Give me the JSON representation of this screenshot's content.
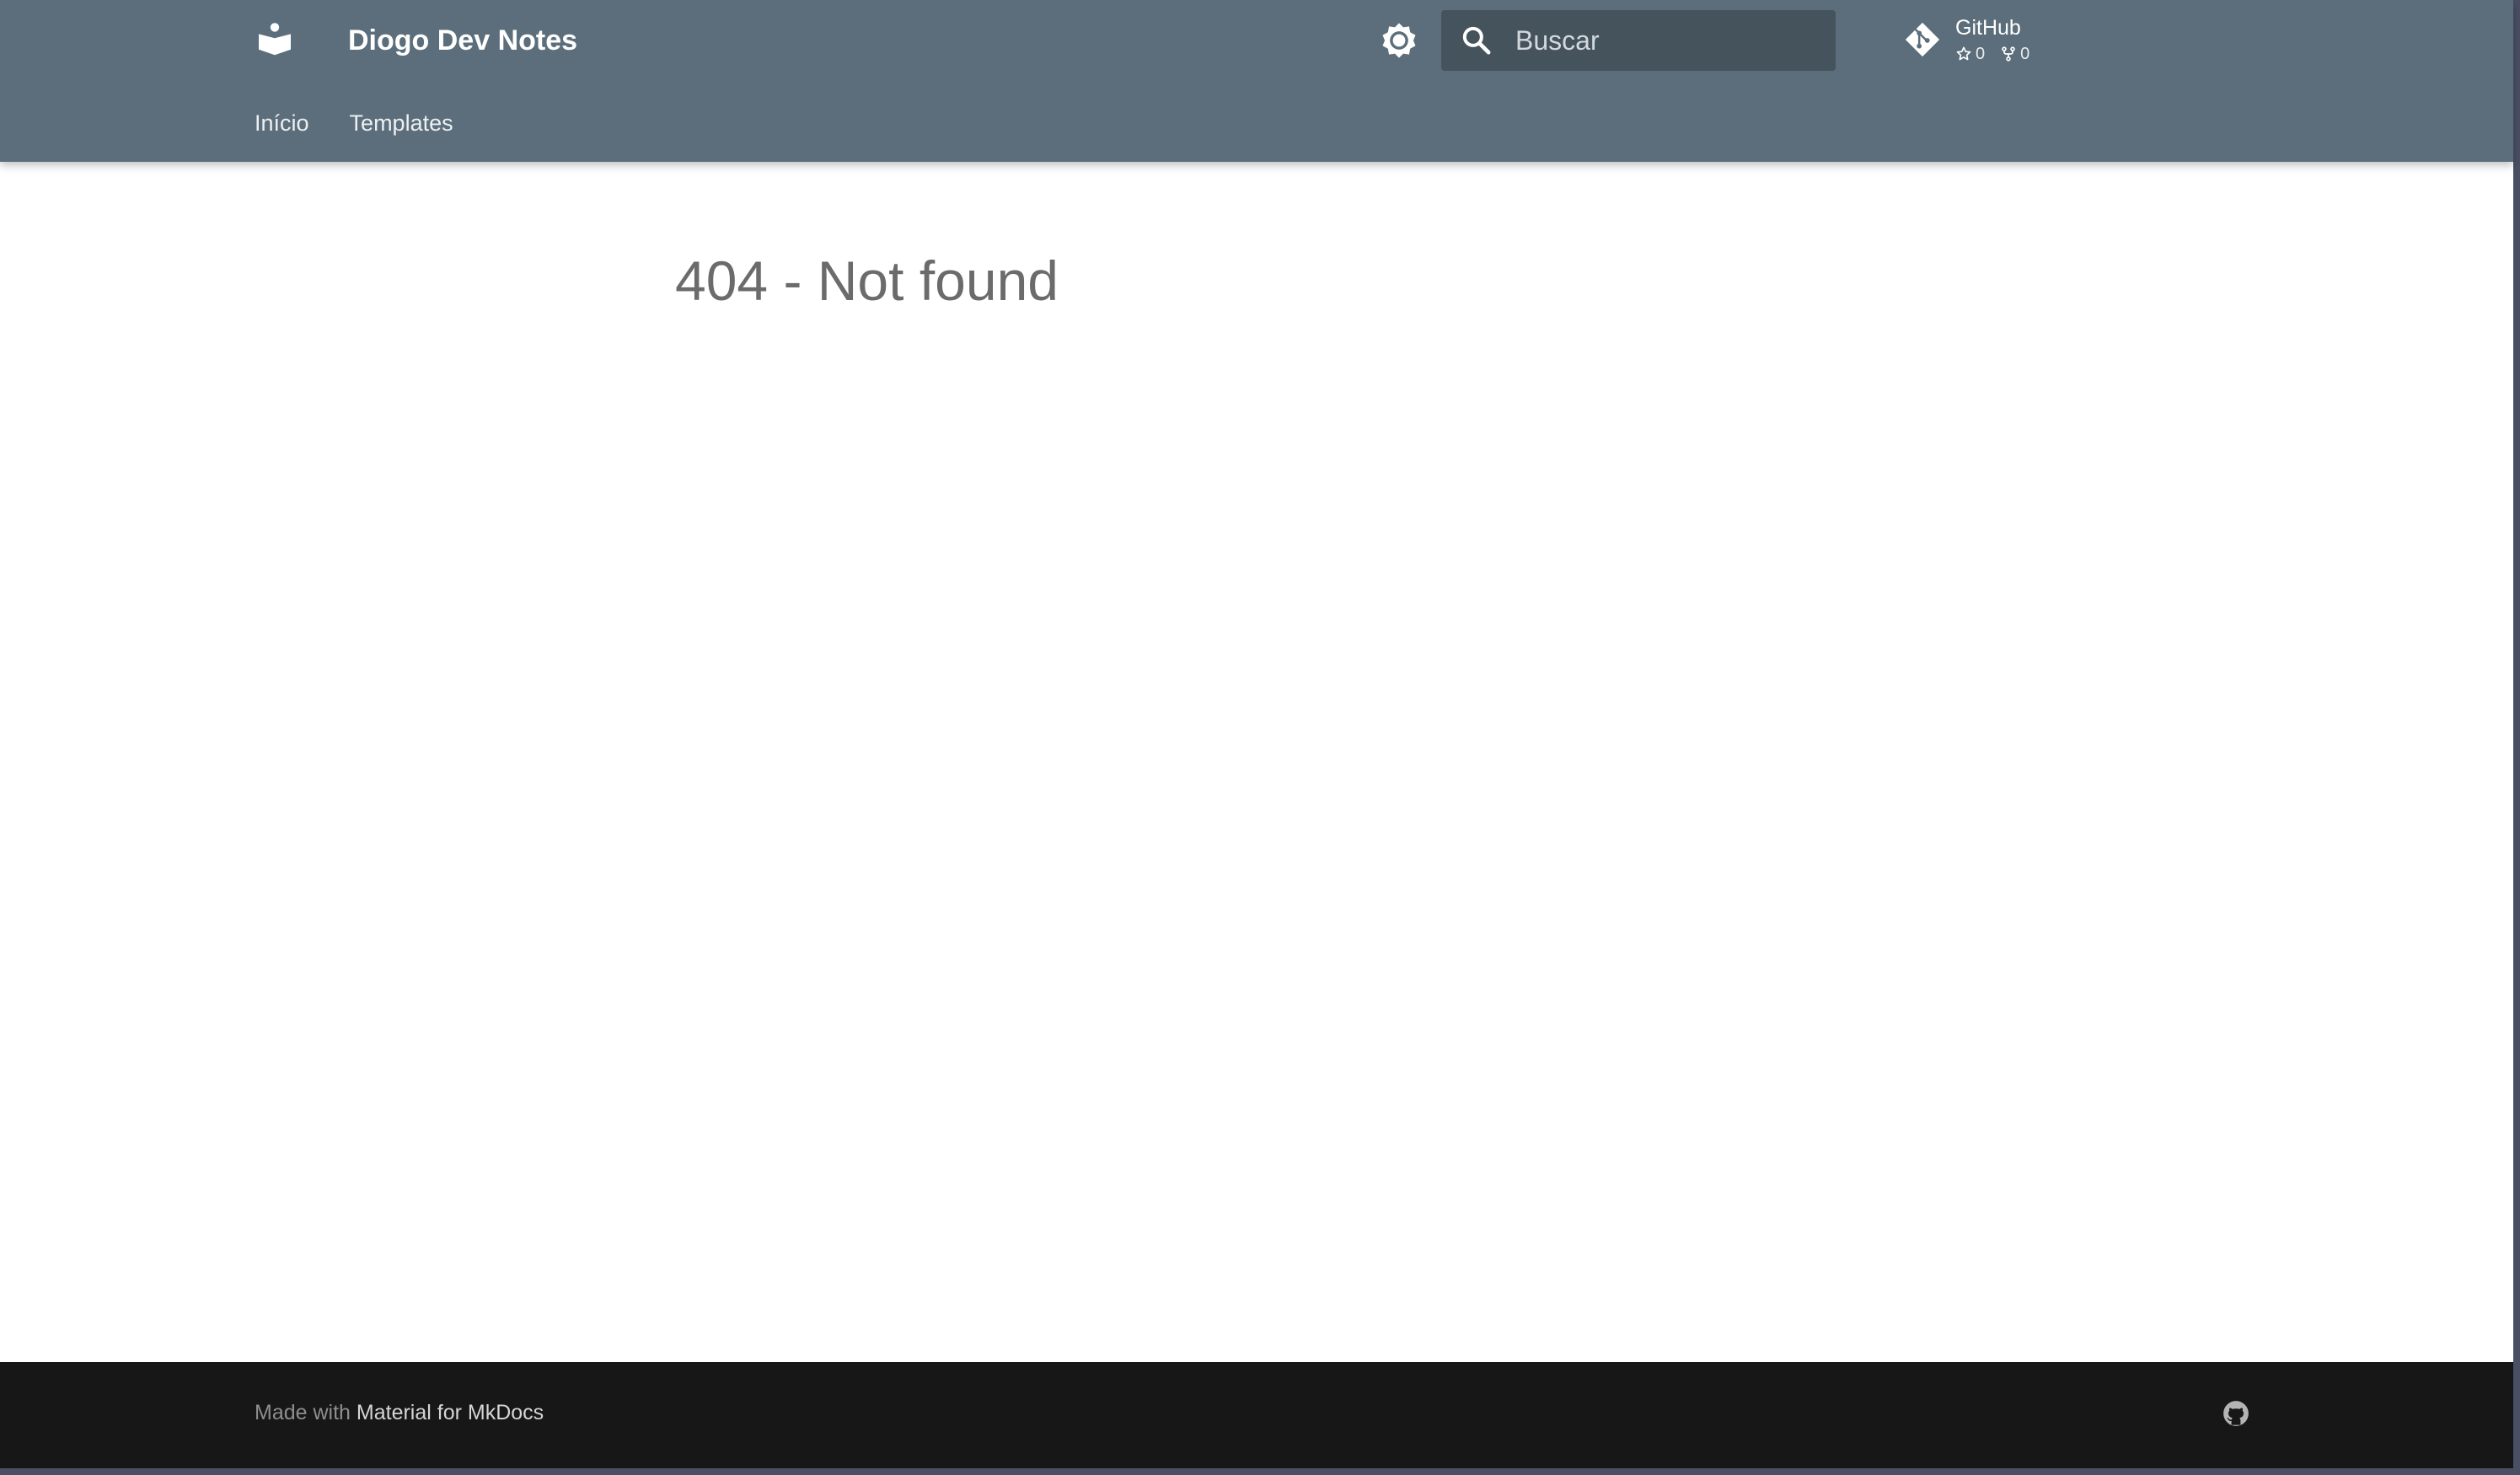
{
  "header": {
    "logo_icon": "book-reader-icon",
    "site_title": "Diogo Dev Notes",
    "theme_toggle_icon": "brightness-icon",
    "search": {
      "icon": "search-icon",
      "placeholder": "Buscar"
    },
    "repo": {
      "icon": "git-icon",
      "name": "GitHub",
      "stars": "0",
      "forks": "0",
      "star_icon": "star-icon",
      "fork_icon": "fork-icon"
    },
    "colors": {
      "primary": "#5c6e7b",
      "search_bg": "#45535d"
    }
  },
  "tabs": [
    {
      "label": "Início"
    },
    {
      "label": "Templates"
    }
  ],
  "main": {
    "title": "404 - Not found"
  },
  "footer": {
    "prefix": "Made with",
    "link": "Material for MkDocs",
    "social_icon": "github-icon",
    "background": "#171717"
  }
}
